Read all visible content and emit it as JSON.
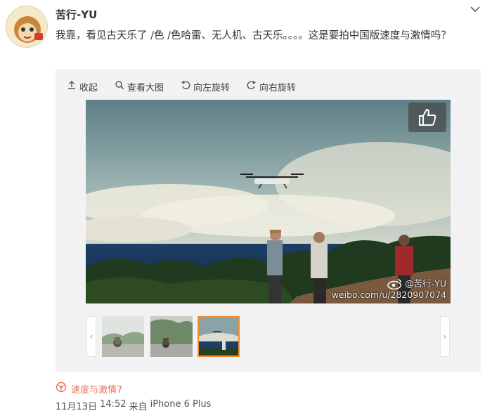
{
  "post": {
    "username": "苦行-YU",
    "text": "我靠，看见古天乐了 /色 /色哈雷、无人机、古天乐。。。。这是要拍中国版速度与激情吗？"
  },
  "toolbar": {
    "collapse_label": "收起",
    "view_large_label": "查看大图",
    "rotate_left_label": "向左旋转",
    "rotate_right_label": "向右旋转"
  },
  "watermark": {
    "handle": "@苦行-YU",
    "url": "weibo.com/u/2820907074"
  },
  "thumbnails": {
    "count": 3,
    "active_index": 2,
    "prev_glyph": "‹",
    "next_glyph": "›"
  },
  "topic": {
    "label": "速度与激情7"
  },
  "meta": {
    "date": "11月13日",
    "time": "14:52",
    "source_prefix": "来自",
    "source": "iPhone 6 Plus"
  },
  "colors": {
    "topic_accent": "#eb7350",
    "active_thumb_border": "#f08f2a"
  },
  "icons": [
    "upload-arrow-icon",
    "search-icon",
    "rotate-left-icon",
    "rotate-right-icon",
    "thumbs-up-icon",
    "weibo-logo-icon",
    "topic-icon",
    "corner-arrow-icon"
  ]
}
